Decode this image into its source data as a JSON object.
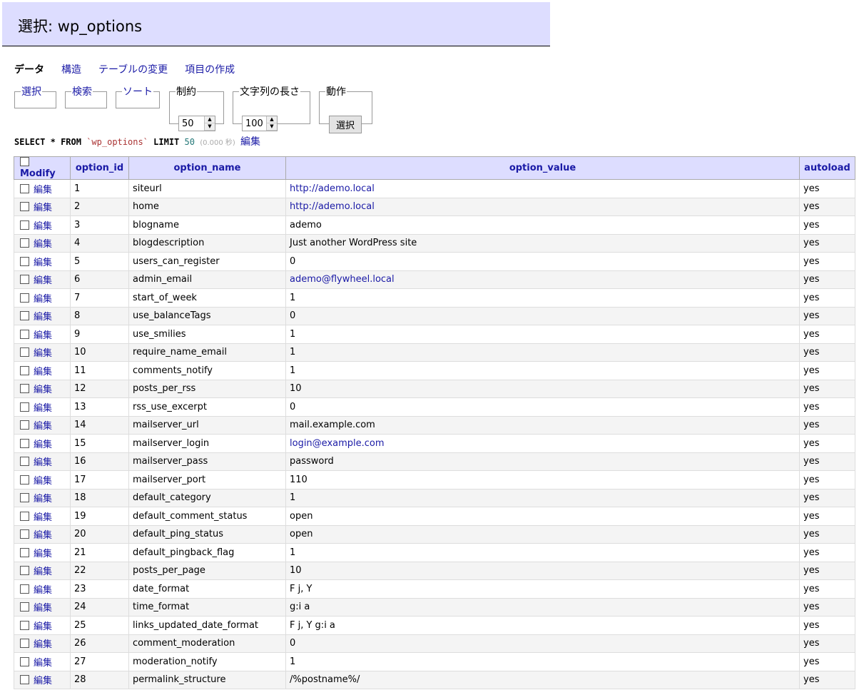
{
  "header": {
    "title": "選択: wp_options"
  },
  "tabs": [
    {
      "label": "データ",
      "active": true
    },
    {
      "label": "構造",
      "active": false
    },
    {
      "label": "テーブルの変更",
      "active": false
    },
    {
      "label": "項目の作成",
      "active": false
    }
  ],
  "controls": {
    "select_legend": "選択",
    "search_legend": "検索",
    "sort_legend": "ソート",
    "limit_legend": "制約",
    "limit_value": "50",
    "textlen_legend": "文字列の長さ",
    "textlen_value": "100",
    "action_legend": "動作",
    "action_button": "選択"
  },
  "sql": {
    "select": "SELECT",
    "star": "*",
    "from": "FROM",
    "table": "`wp_options`",
    "limit": "LIMIT",
    "limit_num": "50",
    "time": "(0.000 秒)",
    "edit": "編集"
  },
  "table": {
    "columns": [
      "Modify",
      "option_id",
      "option_name",
      "option_value",
      "autoload"
    ],
    "edit_label": "編集",
    "rows": [
      {
        "id": "1",
        "name": "siteurl",
        "value": "http://ademo.local",
        "autoload": "yes",
        "link": true
      },
      {
        "id": "2",
        "name": "home",
        "value": "http://ademo.local",
        "autoload": "yes",
        "link": true
      },
      {
        "id": "3",
        "name": "blogname",
        "value": "ademo",
        "autoload": "yes",
        "link": false
      },
      {
        "id": "4",
        "name": "blogdescription",
        "value": "Just another WordPress site",
        "autoload": "yes",
        "link": false
      },
      {
        "id": "5",
        "name": "users_can_register",
        "value": "0",
        "autoload": "yes",
        "link": false
      },
      {
        "id": "6",
        "name": "admin_email",
        "value": "ademo@flywheel.local",
        "autoload": "yes",
        "link": true
      },
      {
        "id": "7",
        "name": "start_of_week",
        "value": "1",
        "autoload": "yes",
        "link": false
      },
      {
        "id": "8",
        "name": "use_balanceTags",
        "value": "0",
        "autoload": "yes",
        "link": false
      },
      {
        "id": "9",
        "name": "use_smilies",
        "value": "1",
        "autoload": "yes",
        "link": false
      },
      {
        "id": "10",
        "name": "require_name_email",
        "value": "1",
        "autoload": "yes",
        "link": false
      },
      {
        "id": "11",
        "name": "comments_notify",
        "value": "1",
        "autoload": "yes",
        "link": false
      },
      {
        "id": "12",
        "name": "posts_per_rss",
        "value": "10",
        "autoload": "yes",
        "link": false
      },
      {
        "id": "13",
        "name": "rss_use_excerpt",
        "value": "0",
        "autoload": "yes",
        "link": false
      },
      {
        "id": "14",
        "name": "mailserver_url",
        "value": "mail.example.com",
        "autoload": "yes",
        "link": false
      },
      {
        "id": "15",
        "name": "mailserver_login",
        "value": "login@example.com",
        "autoload": "yes",
        "link": true
      },
      {
        "id": "16",
        "name": "mailserver_pass",
        "value": "password",
        "autoload": "yes",
        "link": false
      },
      {
        "id": "17",
        "name": "mailserver_port",
        "value": "110",
        "autoload": "yes",
        "link": false
      },
      {
        "id": "18",
        "name": "default_category",
        "value": "1",
        "autoload": "yes",
        "link": false
      },
      {
        "id": "19",
        "name": "default_comment_status",
        "value": "open",
        "autoload": "yes",
        "link": false
      },
      {
        "id": "20",
        "name": "default_ping_status",
        "value": "open",
        "autoload": "yes",
        "link": false
      },
      {
        "id": "21",
        "name": "default_pingback_flag",
        "value": "1",
        "autoload": "yes",
        "link": false
      },
      {
        "id": "22",
        "name": "posts_per_page",
        "value": "10",
        "autoload": "yes",
        "link": false
      },
      {
        "id": "23",
        "name": "date_format",
        "value": "F j, Y",
        "autoload": "yes",
        "link": false
      },
      {
        "id": "24",
        "name": "time_format",
        "value": "g:i a",
        "autoload": "yes",
        "link": false
      },
      {
        "id": "25",
        "name": "links_updated_date_format",
        "value": "F j, Y g:i a",
        "autoload": "yes",
        "link": false
      },
      {
        "id": "26",
        "name": "comment_moderation",
        "value": "0",
        "autoload": "yes",
        "link": false
      },
      {
        "id": "27",
        "name": "moderation_notify",
        "value": "1",
        "autoload": "yes",
        "link": false
      },
      {
        "id": "28",
        "name": "permalink_structure",
        "value": "/%postname%/",
        "autoload": "yes",
        "link": false
      }
    ]
  }
}
